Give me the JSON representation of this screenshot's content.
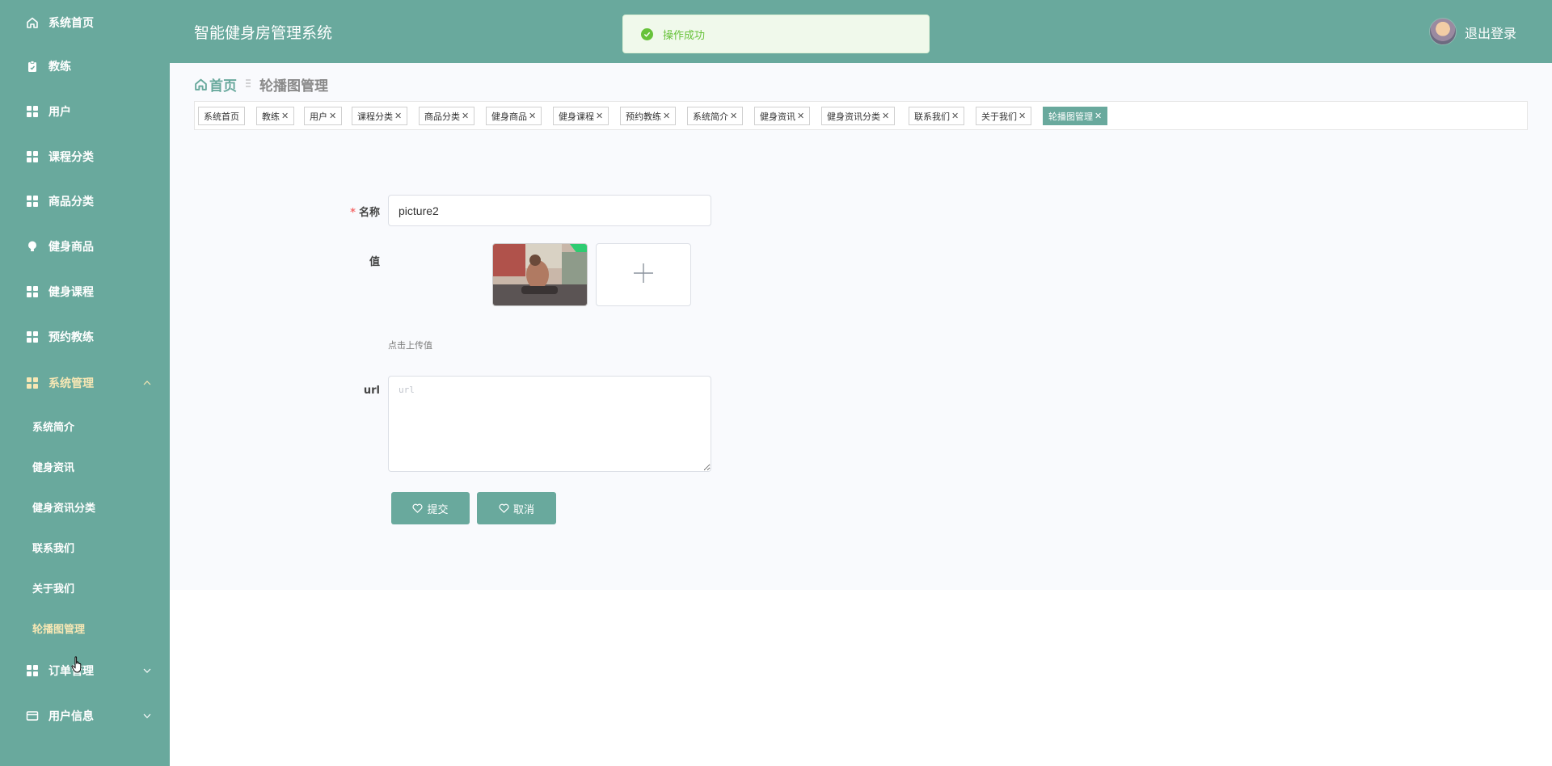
{
  "header": {
    "app_title": "智能健身房管理系统",
    "toast": "操作成功",
    "logout": "退出登录"
  },
  "sidebar": {
    "items": [
      {
        "label": "系统首页",
        "icon": "home-icon"
      },
      {
        "label": "教练",
        "icon": "clipboard-icon"
      },
      {
        "label": "用户",
        "icon": "grid-icon"
      },
      {
        "label": "课程分类",
        "icon": "grid-icon"
      },
      {
        "label": "商品分类",
        "icon": "grid-icon"
      },
      {
        "label": "健身商品",
        "icon": "bulb-icon"
      },
      {
        "label": "健身课程",
        "icon": "grid-icon"
      },
      {
        "label": "预约教练",
        "icon": "grid-icon"
      },
      {
        "label": "系统管理",
        "icon": "grid-icon"
      },
      {
        "label": "订单管理",
        "icon": "grid-icon"
      },
      {
        "label": "用户信息",
        "icon": "card-icon"
      }
    ],
    "sub_items": [
      {
        "label": "系统简介"
      },
      {
        "label": "健身资讯"
      },
      {
        "label": "健身资讯分类"
      },
      {
        "label": "联系我们"
      },
      {
        "label": "关于我们"
      },
      {
        "label": "轮播图管理"
      }
    ]
  },
  "breadcrumb": {
    "home": "首页",
    "current": "轮播图管理"
  },
  "tags": [
    {
      "label": "系统首页"
    },
    {
      "label": "教练"
    },
    {
      "label": "用户"
    },
    {
      "label": "课程分类"
    },
    {
      "label": "商品分类"
    },
    {
      "label": "健身商品"
    },
    {
      "label": "健身课程"
    },
    {
      "label": "预约教练"
    },
    {
      "label": "系统简介"
    },
    {
      "label": "健身资讯"
    },
    {
      "label": "健身资讯分类"
    },
    {
      "label": "联系我们"
    },
    {
      "label": "关于我们"
    },
    {
      "label": "轮播图管理"
    }
  ],
  "form": {
    "name_label": "名称",
    "name_value": "picture2",
    "value_label": "值",
    "upload_hint": "点击上传值",
    "url_label": "url",
    "url_placeholder": "url",
    "submit": "提交",
    "cancel": "取消"
  },
  "colors": {
    "primary": "#69a99d",
    "active_text": "#f7e7b4",
    "success": "#67c23a"
  }
}
